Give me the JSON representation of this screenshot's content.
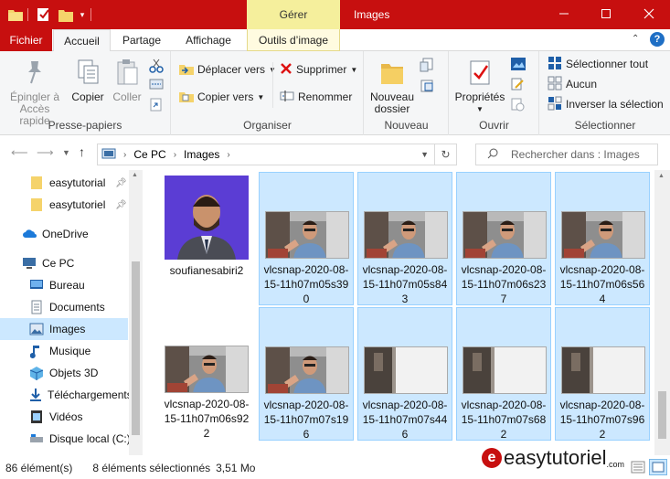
{
  "window": {
    "title": "Images",
    "context_group": "Gérer",
    "minimize_icon": "minimize-icon",
    "maximize_icon": "maximize-icon",
    "close_icon": "close-icon"
  },
  "tabs": [
    {
      "label": "Fichier"
    },
    {
      "label": "Accueil"
    },
    {
      "label": "Partage"
    },
    {
      "label": "Affichage"
    },
    {
      "label": "Outils d’image"
    }
  ],
  "ribbon": {
    "clipboard": {
      "label": "Presse-papiers",
      "pin": "Épingler à\nAccès rapide",
      "pin_l1": "Épingler à",
      "pin_l2": "Accès rapide",
      "copy": "Copier",
      "paste": "Coller"
    },
    "organize": {
      "label": "Organiser",
      "move": "Déplacer vers",
      "copy_to": "Copier vers",
      "delete": "Supprimer",
      "rename": "Renommer"
    },
    "new": {
      "label": "Nouveau",
      "folder_l1": "Nouveau",
      "folder_l2": "dossier"
    },
    "open": {
      "label": "Ouvrir",
      "properties": "Propriétés"
    },
    "select": {
      "label": "Sélectionner",
      "all": "Sélectionner tout",
      "none": "Aucun",
      "invert": "Inverser la sélection"
    }
  },
  "address": {
    "crumb1": "Ce PC",
    "crumb2": "Images",
    "search_placeholder": "Rechercher dans : Images"
  },
  "nav": [
    {
      "label": "easytutorial"
    },
    {
      "label": "easytutoriel"
    },
    {
      "label": "OneDrive"
    },
    {
      "label": "Ce PC"
    },
    {
      "label": "Bureau"
    },
    {
      "label": "Documents"
    },
    {
      "label": "Images"
    },
    {
      "label": "Musique"
    },
    {
      "label": "Objets 3D"
    },
    {
      "label": "Téléchargements"
    },
    {
      "label": "Vidéos"
    },
    {
      "label": "Disque local (C:)"
    }
  ],
  "files": [
    {
      "l1": "soufianesabiri2",
      "l2": "",
      "l3": "",
      "selected": false
    },
    {
      "l1": "vlcsnap-2020-08-",
      "l2": "15-11h07m05s39",
      "l3": "0",
      "selected": true
    },
    {
      "l1": "vlcsnap-2020-08-",
      "l2": "15-11h07m05s84",
      "l3": "3",
      "selected": true
    },
    {
      "l1": "vlcsnap-2020-08-",
      "l2": "15-11h07m06s23",
      "l3": "7",
      "selected": true
    },
    {
      "l1": "vlcsnap-2020-08-",
      "l2": "15-11h07m06s56",
      "l3": "4",
      "selected": true
    },
    {
      "l1": "vlcsnap-2020-08-",
      "l2": "15-11h07m06s92",
      "l3": "2",
      "selected": false
    },
    {
      "l1": "vlcsnap-2020-08-",
      "l2": "15-11h07m07s19",
      "l3": "6",
      "selected": true
    },
    {
      "l1": "vlcsnap-2020-08-",
      "l2": "15-11h07m07s44",
      "l3": "6",
      "selected": true
    },
    {
      "l1": "vlcsnap-2020-08-",
      "l2": "15-11h07m07s68",
      "l3": "2",
      "selected": true
    },
    {
      "l1": "vlcsnap-2020-08-",
      "l2": "15-11h07m07s96",
      "l3": "2",
      "selected": true
    }
  ],
  "status": {
    "count": "86 élément(s)",
    "selection": "8 éléments sélectionnés",
    "size": "3,51 Mo"
  },
  "watermark": {
    "logo_letter": "e",
    "text": "easytutoriel",
    "suffix": ".com"
  },
  "colors": {
    "accent": "#c70f0f",
    "selection": "#cce8ff",
    "context_tab": "#f5ef9c"
  }
}
